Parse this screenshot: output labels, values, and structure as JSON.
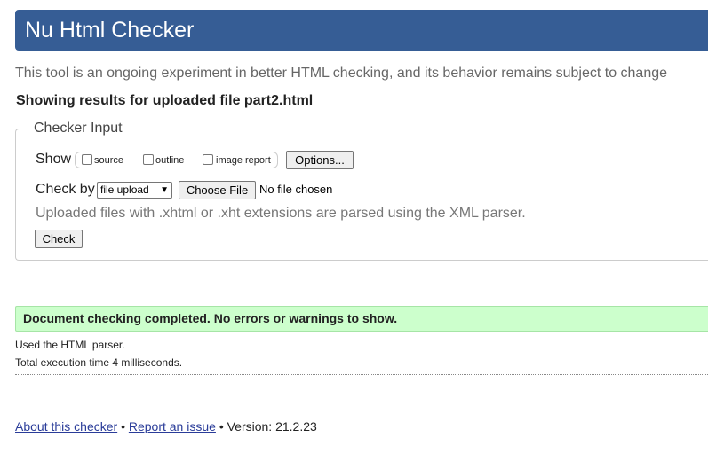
{
  "header": {
    "title": "Nu Html Checker"
  },
  "intro": {
    "text": "This tool is an ongoing experiment in better HTML checking, and its behavior remains subject to change"
  },
  "results_heading": "Showing results for uploaded file part2.html",
  "checker_input": {
    "legend": "Checker Input",
    "show_label": "Show",
    "show_options": [
      {
        "label": "source",
        "checked": false
      },
      {
        "label": "outline",
        "checked": false
      },
      {
        "label": "image report",
        "checked": false
      }
    ],
    "options_button": "Options...",
    "check_by_label": "Check by",
    "check_by_selected": "file upload",
    "choose_file_button": "Choose File",
    "no_file_text": "No file chosen",
    "xml_note": "Uploaded files with .xhtml or .xht extensions are parsed using the XML parser.",
    "check_button": "Check"
  },
  "result": {
    "success_message": "Document checking completed. No errors or warnings to show.",
    "parser_note": "Used the HTML parser.",
    "time_note": "Total execution time 4 milliseconds."
  },
  "footer": {
    "about_link": "About this checker",
    "separator": "•",
    "report_link": "Report an issue",
    "version_text": "Version: 21.2.23"
  }
}
